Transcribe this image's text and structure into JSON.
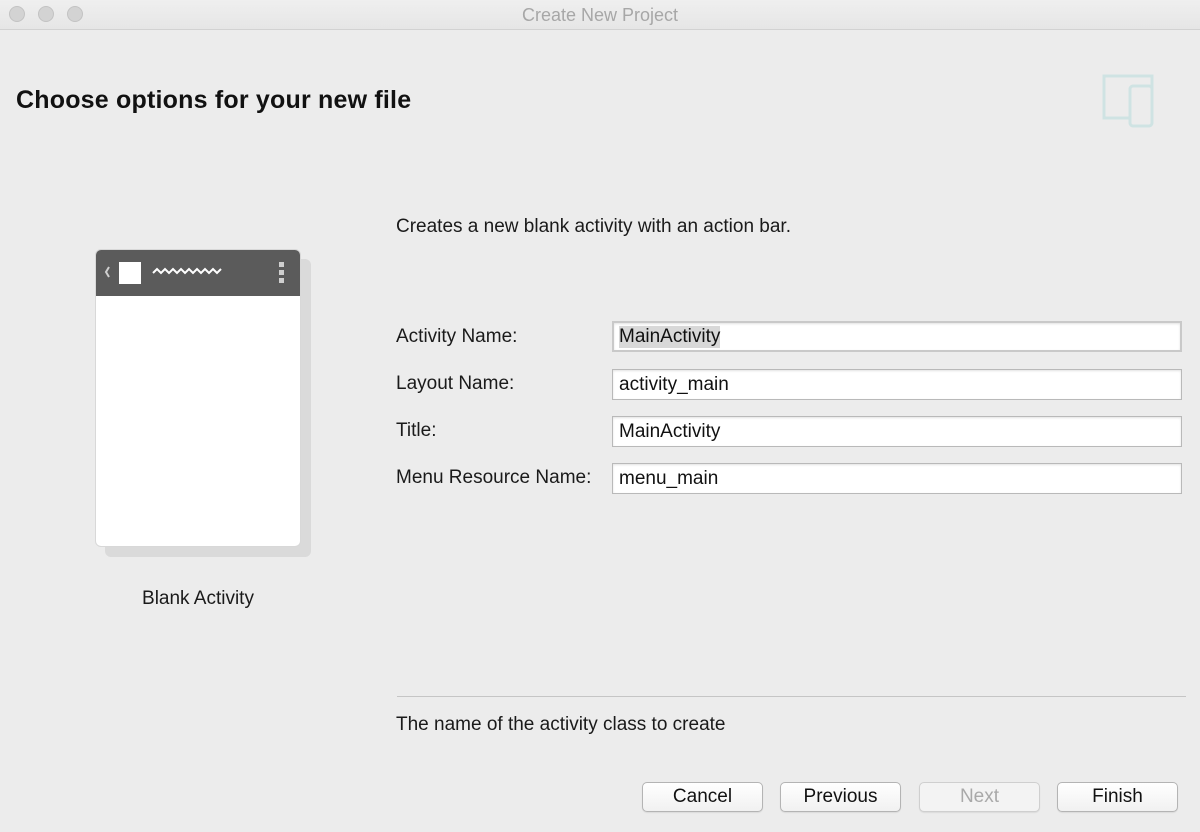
{
  "window": {
    "title": "Create New Project",
    "traffic_lights": [
      "close-button",
      "minimize-button",
      "zoom-button"
    ]
  },
  "header": {
    "title": "Choose options for your new file",
    "icon": "device-icon"
  },
  "template": {
    "name": "Blank Activity",
    "description": "Creates a new blank activity with an action bar."
  },
  "form": {
    "fields": [
      {
        "label": "Activity Name:",
        "value": "MainActivity",
        "focused": true
      },
      {
        "label": "Layout Name:",
        "value": "activity_main"
      },
      {
        "label": "Title:",
        "value": "MainActivity"
      },
      {
        "label": "Menu Resource Name:",
        "value": "menu_main"
      }
    ]
  },
  "help_text": "The name of the activity class to create",
  "buttons": {
    "cancel": "Cancel",
    "previous": "Previous",
    "next": "Next",
    "finish": "Finish"
  },
  "colors": {
    "window_bg": "#ececec",
    "action_bar": "#5b5b5b",
    "device_icon": "#cfe3e3"
  }
}
